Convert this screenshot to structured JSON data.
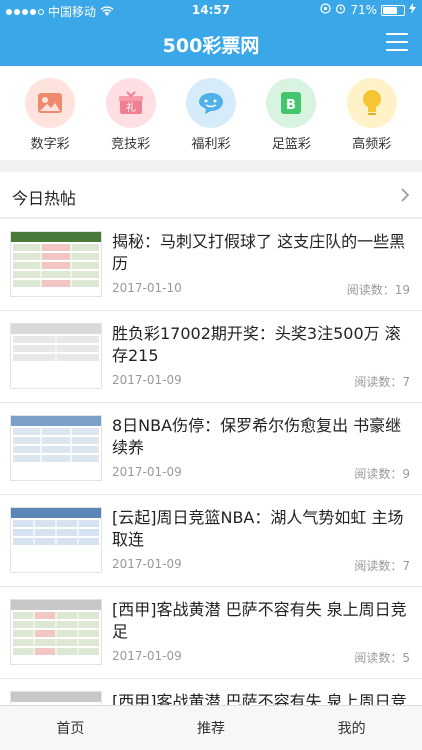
{
  "status": {
    "carrier": "中国移动",
    "time": "14:57",
    "battery": "71%",
    "battery_level": 0.71
  },
  "header": {
    "title": "500彩票网"
  },
  "categories": [
    {
      "label": "数字彩",
      "icon": "picture-icon",
      "color": "#ffe3dc",
      "accent": "#f08a6e"
    },
    {
      "label": "竞技彩",
      "icon": "gift-icon",
      "color": "#ffdfe4",
      "accent": "#f07f92"
    },
    {
      "label": "福利彩",
      "icon": "chat-bubble-icon",
      "color": "#d7ecfb",
      "accent": "#4fb0ea"
    },
    {
      "label": "足篮彩",
      "icon": "letter-b-icon",
      "color": "#d8f3e0",
      "accent": "#45c56e"
    },
    {
      "label": "高频彩",
      "icon": "lightbulb-icon",
      "color": "#fff1c8",
      "accent": "#f5c632"
    }
  ],
  "hot": {
    "title": "今日热帖"
  },
  "posts": [
    {
      "title": "揭秘：马刺又打假球了 这支庄队的一些黑历",
      "date": "2017-01-10",
      "reads": "阅读数：19"
    },
    {
      "title": "胜负彩17002期开奖：头奖3注500万 滚存215",
      "date": "2017-01-09",
      "reads": "阅读数：7"
    },
    {
      "title": "8日NBA伤停：保罗希尔伤愈复出 书豪继续养",
      "date": "2017-01-09",
      "reads": "阅读数：9"
    },
    {
      "title": "[云起]周日竞篮NBA：湖人气势如虹 主场取连",
      "date": "2017-01-09",
      "reads": "阅读数：7"
    },
    {
      "title": "[西甲]客战黄潜 巴萨不容有失 泉上周日竞足",
      "date": "2017-01-09",
      "reads": "阅读数：5"
    },
    {
      "title": "[西甲]客战黄潜 巴萨不容有失 泉上周日竞足",
      "date": "",
      "reads": ""
    }
  ],
  "tabs": [
    {
      "label": "首页"
    },
    {
      "label": "推荐"
    },
    {
      "label": "我的"
    }
  ]
}
